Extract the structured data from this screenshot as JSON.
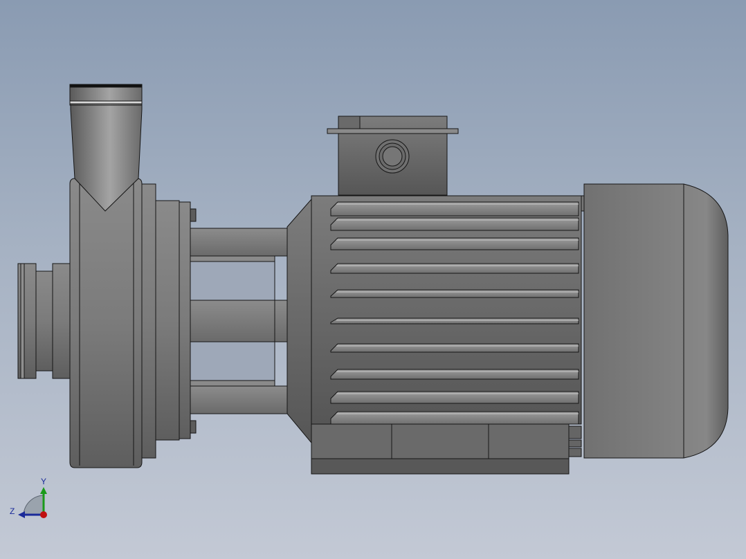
{
  "viewport": {
    "background_top": "#8a9bb2",
    "background_bottom": "#c3c9d5",
    "model": {
      "pump_casing_color": "#7a7a7a",
      "motor_body_color": "#6e6e6e",
      "edge_color": "#151515"
    }
  },
  "triad": {
    "y_label": "Y",
    "z_label": "Z",
    "y_color": "#1a9a1a",
    "z_color": "#1a2a99",
    "x_color": "#c01010"
  }
}
